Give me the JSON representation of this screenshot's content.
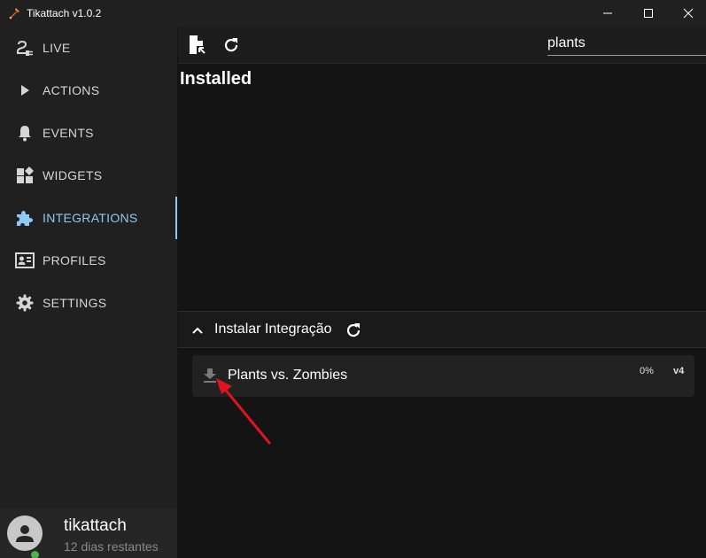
{
  "window": {
    "title": "Tikattach v1.0.2",
    "logo_icon": "fire-tool-icon"
  },
  "sidebar": {
    "items": [
      {
        "id": "live",
        "label": "LIVE",
        "icon": "plug-icon"
      },
      {
        "id": "actions",
        "label": "ACTIONS",
        "icon": "play-icon"
      },
      {
        "id": "events",
        "label": "EVENTS",
        "icon": "bell-icon"
      },
      {
        "id": "widgets",
        "label": "WIDGETS",
        "icon": "widgets-icon"
      },
      {
        "id": "integrations",
        "label": "INTEGRATIONS",
        "icon": "puzzle-icon",
        "active": true
      },
      {
        "id": "profiles",
        "label": "PROFILES",
        "icon": "profile-card-icon"
      },
      {
        "id": "settings",
        "label": "SETTINGS",
        "icon": "gear-icon"
      }
    ],
    "user": {
      "name": "tikattach",
      "subtitle": "12 dias restantes",
      "status": "online"
    }
  },
  "toolbar": {
    "search_value": "plants"
  },
  "main": {
    "section_title": "Installed",
    "install_panel": {
      "title": "Instalar Integração",
      "expanded": true
    },
    "integrations": [
      {
        "name": "Plants vs. Zombies",
        "progress": "0%",
        "version": "v4"
      }
    ]
  },
  "colors": {
    "accent": "#8fc9f4",
    "sidebar_bg": "#202020",
    "main_bg": "#141414",
    "status_online": "#4caf50",
    "annotation": "#e0141e"
  }
}
